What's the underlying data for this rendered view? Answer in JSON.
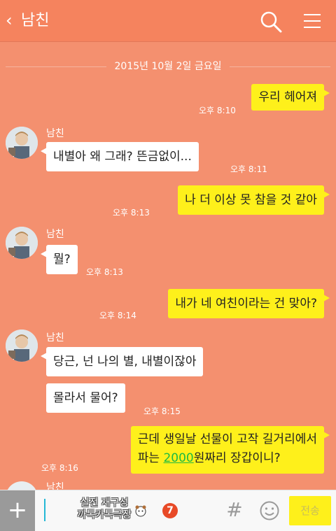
{
  "header": {
    "back_symbol": "‹",
    "title": "남친",
    "icons": {
      "back": "back-chevron-icon",
      "search": "search-icon",
      "menu": "hamburger-menu-icon"
    }
  },
  "chat": {
    "date_divider": "2015년 10월 2일 금요일",
    "messages": [
      {
        "from": "me",
        "text": "우리 헤어져",
        "time": "오후 8:10"
      },
      {
        "from": "them",
        "sender": "남친",
        "text": "내별아 왜 그래? 뜬금없이...",
        "time": "오후 8:11"
      },
      {
        "from": "me",
        "text": "나 더 이상 못 참을 것 같아",
        "time": "오후 8:13"
      },
      {
        "from": "them",
        "sender": "남친",
        "text": "뭘?",
        "time": "오후 8:13"
      },
      {
        "from": "me",
        "text": "내가 네 여친이라는 건 맞아?",
        "time": "오후 8:14"
      },
      {
        "from": "them",
        "sender": "남친",
        "text": "당근, 넌 나의 별, 내별이잖아"
      },
      {
        "from": "them",
        "text": "몰라서 물어?",
        "time": "오후 8:15"
      },
      {
        "from": "me",
        "text_line1": "근데 생일날 선물이 고작 길거리에서",
        "text_line2_pre": "파는 ",
        "text_line2_highlight": "2000",
        "text_line2_post": "원짜리 장갑이니?",
        "time": "오후 8:16"
      },
      {
        "from": "them",
        "sender": "남친"
      }
    ]
  },
  "input_bar": {
    "plus_label": "+",
    "watermark_line1": "실전 재구성",
    "watermark_line2": "까톡카톡극장",
    "emoji_label": "7",
    "hash_label": "#",
    "send_label": "전송",
    "icons": {
      "emoticon": "bear-emoticon-icon",
      "smile": "smile-icon"
    }
  },
  "colors": {
    "background": "#f4906f",
    "my_bubble": "#fef01b",
    "their_bubble": "#ffffff",
    "link": "#1dbb41"
  }
}
